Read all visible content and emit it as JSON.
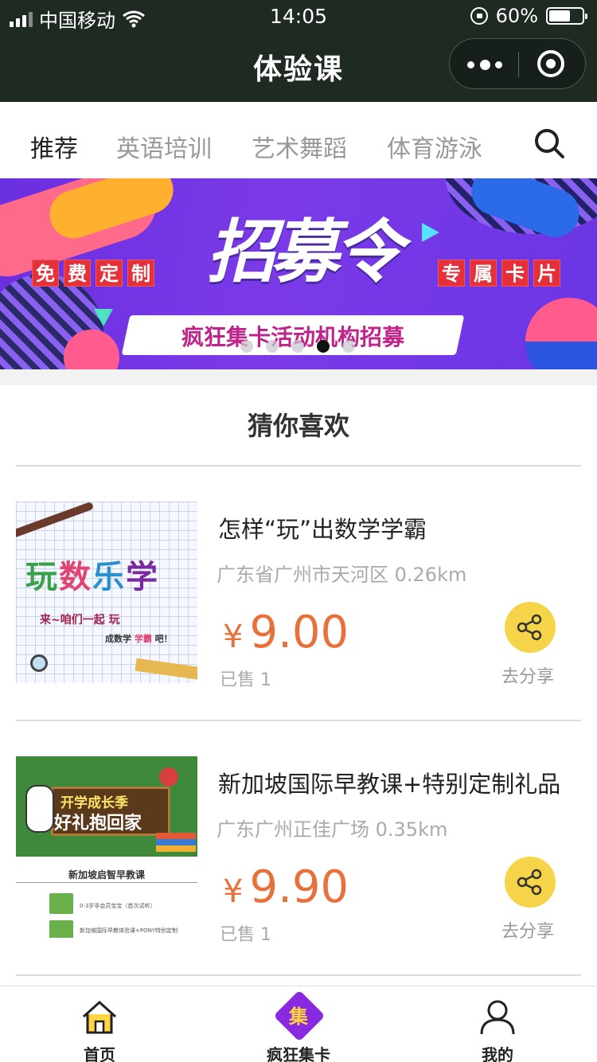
{
  "status_bar": {
    "carrier": "中国移动",
    "time": "14:05",
    "battery": "60%",
    "battery_level": 0.6
  },
  "title_bar": {
    "title": "体验课"
  },
  "tabs": [
    {
      "label": "推荐",
      "active": true
    },
    {
      "label": "英语培训",
      "active": false
    },
    {
      "label": "艺术舞蹈",
      "active": false
    },
    {
      "label": "体育游泳",
      "active": false
    }
  ],
  "banner": {
    "headline": "招募令",
    "left_tag": [
      "免",
      "费",
      "定",
      "制"
    ],
    "right_tag": [
      "专",
      "属",
      "卡",
      "片"
    ],
    "slogan": "疯狂集卡活动机构招募",
    "slide_count": 5,
    "active_slide": 4
  },
  "section": {
    "title": "猜你喜欢"
  },
  "products": [
    {
      "name": "怎样“玩”出数学学霸",
      "location": "广东省广州市天河区 0.26km",
      "currency": "¥",
      "price": "9.00",
      "sold": "已售 1",
      "share_label": "去分享",
      "thumb": {
        "word": [
          "玩",
          "数",
          "乐",
          "学"
        ],
        "line1": "来~咱们一起 玩",
        "line2_a": "成数学 ",
        "line2_b": "学霸",
        "line2_c": " 吧！"
      }
    },
    {
      "name": "新加坡国际早教课+特别定制礼品",
      "location": "广东广州正佳广场 0.35km",
      "currency": "¥",
      "price": "9.90",
      "sold": "已售 1",
      "share_label": "去分享",
      "thumb": {
        "line1": "开学成长季",
        "line2": "好礼抱回家",
        "caption": "新加坡启智早教课",
        "row1": "0-3岁非会员宝宝（首次试听）",
        "row2": "新加坡国际早教体验课+PONY特别定制"
      }
    }
  ],
  "tabbar": [
    {
      "label": "首页",
      "icon": "home-icon"
    },
    {
      "label": "疯狂集卡",
      "icon": "jika-icon",
      "icon_text": "集"
    },
    {
      "label": "我的",
      "icon": "user-icon"
    }
  ],
  "colors": {
    "topbar": "#1e2a22",
    "price": "#e8703a",
    "share": "#f5d44a",
    "banner": "#7b3ae8"
  }
}
